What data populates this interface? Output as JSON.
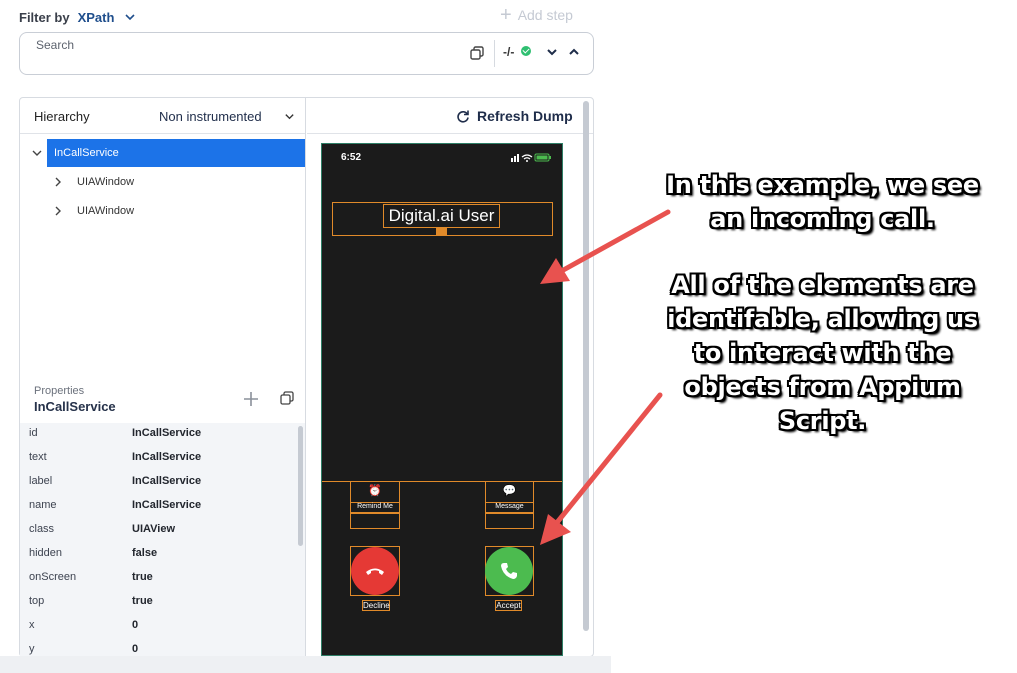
{
  "toolbar": {
    "filter_label": "Filter by",
    "filter_value": "XPath",
    "add_step_label": "Add step"
  },
  "search": {
    "placeholder": "Search",
    "match_count": "-/-"
  },
  "hierarchy": {
    "title": "Hierarchy",
    "mode": "Non instrumented",
    "nodes": [
      {
        "label": "InCallService",
        "selected": true
      },
      {
        "label": "UIAWindow"
      },
      {
        "label": "UIAWindow"
      }
    ]
  },
  "properties": {
    "caption": "Properties",
    "title": "InCallService",
    "rows": [
      {
        "key": "id",
        "value": "InCallService"
      },
      {
        "key": "text",
        "value": "InCallService"
      },
      {
        "key": "label",
        "value": "InCallService"
      },
      {
        "key": "name",
        "value": "InCallService"
      },
      {
        "key": "class",
        "value": "UIAView"
      },
      {
        "key": "hidden",
        "value": "false"
      },
      {
        "key": "onScreen",
        "value": "true"
      },
      {
        "key": "top",
        "value": "true"
      },
      {
        "key": "x",
        "value": "0"
      },
      {
        "key": "y",
        "value": "0"
      }
    ]
  },
  "dump": {
    "refresh_label": "Refresh Dump"
  },
  "phone": {
    "time": "6:52",
    "caller": "Digital.ai User",
    "remind_label": "Remind Me",
    "message_label": "Message",
    "decline_label": "Decline",
    "accept_label": "Accept"
  },
  "annotations": {
    "note1_line1": "In this example, we see",
    "note1_line2": "an incoming call.",
    "note2_line1": "All of the elements are",
    "note2_line2": "identifable, allowing us",
    "note2_line3": "to interact with the",
    "note2_line4": "objects from Appium",
    "note2_line5": "Script."
  },
  "colors": {
    "accent": "#1c73e8",
    "element_outline": "#e08a2a",
    "decline": "#e53935",
    "accept": "#4cbb4f",
    "arrow": "#e8524f"
  }
}
